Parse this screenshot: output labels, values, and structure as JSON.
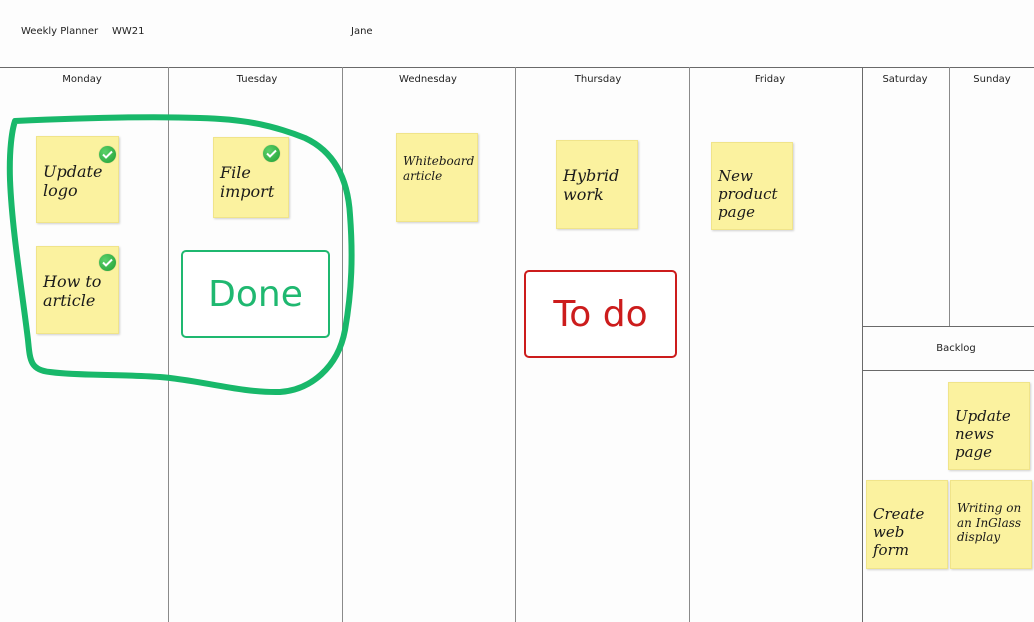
{
  "header": {
    "title": "Weekly Planner",
    "week": "WW21",
    "owner": "Jane"
  },
  "days": [
    {
      "label": "Monday"
    },
    {
      "label": "Tuesday"
    },
    {
      "label": "Wednesday"
    },
    {
      "label": "Thursday"
    },
    {
      "label": "Friday"
    },
    {
      "label": "Saturday"
    },
    {
      "label": "Sunday"
    }
  ],
  "backlog": {
    "label": "Backlog",
    "notes": [
      {
        "text": "Update\nnews\npage"
      },
      {
        "text": "Create\nweb form"
      },
      {
        "text": "Writing on\nan InGlass\ndisplay"
      }
    ]
  },
  "notes": {
    "monday": [
      {
        "text": "Update\nlogo",
        "done": true
      },
      {
        "text": "How to\narticle",
        "done": true
      }
    ],
    "tuesday": [
      {
        "text": "File\nimport",
        "done": true
      }
    ],
    "wednesday": [
      {
        "text": "Whiteboard\narticle",
        "done": false
      }
    ],
    "thursday": [
      {
        "text": "Hybrid\nwork",
        "done": false
      }
    ],
    "friday": [
      {
        "text": "New\nproduct\npage",
        "done": false
      }
    ]
  },
  "labels": {
    "done": "Done",
    "todo": "To do"
  },
  "colors": {
    "note_yellow": "#fbf29f",
    "done_green": "#1fb870",
    "todo_red": "#cc1c1c",
    "check_green": "#2bb043",
    "lasso_green": "#18b86a"
  }
}
